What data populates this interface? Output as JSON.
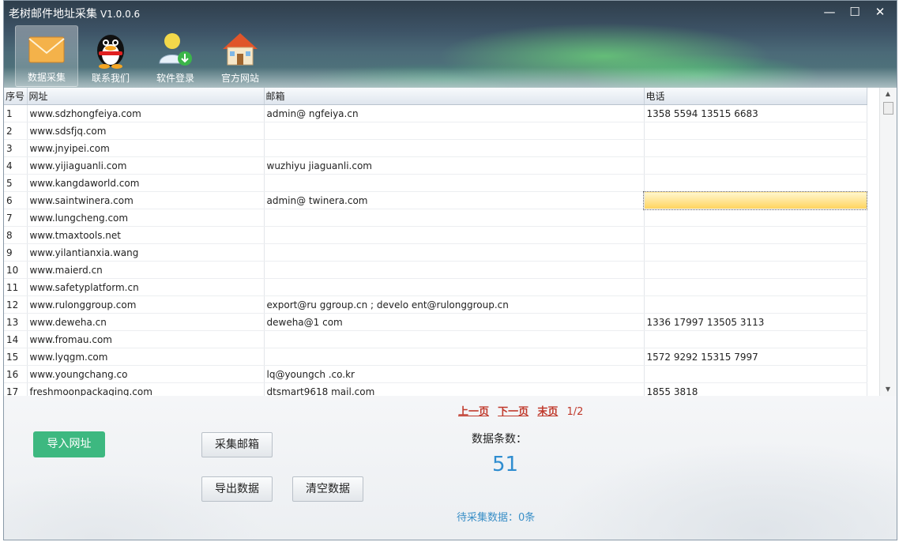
{
  "window": {
    "title": "老树邮件地址采集",
    "version": "V1.0.0.6",
    "controls": {
      "minimize": "—",
      "maximize": "☐",
      "close": "✕"
    }
  },
  "nav": [
    {
      "label": "数据采集",
      "icon": "envelope-icon"
    },
    {
      "label": "联系我们",
      "icon": "qq-penguin-icon"
    },
    {
      "label": "软件登录",
      "icon": "user-download-icon"
    },
    {
      "label": "官方网站",
      "icon": "house-icon"
    }
  ],
  "table": {
    "headers": {
      "index": "序号",
      "url": "网址",
      "email": "邮箱",
      "phone": "电话"
    },
    "rows": [
      {
        "index": "1",
        "url": "www.sdzhongfeiya.com",
        "email": "admin@  ngfeiya.cn",
        "phone": "1358   5594 13515   6683"
      },
      {
        "index": "2",
        "url": "www.sdsfjq.com",
        "email": "",
        "phone": ""
      },
      {
        "index": "3",
        "url": "www.jnyipei.com",
        "email": "",
        "phone": ""
      },
      {
        "index": "4",
        "url": "www.yijiaguanli.com",
        "email": "wuzhiyu   jiaguanli.com",
        "phone": ""
      },
      {
        "index": "5",
        "url": "www.kangdaworld.com",
        "email": "",
        "phone": ""
      },
      {
        "index": "6",
        "url": "www.saintwinera.com",
        "email": "admin@   twinera.com",
        "phone": ""
      },
      {
        "index": "7",
        "url": "www.lungcheng.com",
        "email": "",
        "phone": ""
      },
      {
        "index": "8",
        "url": "www.tmaxtools.net",
        "email": "",
        "phone": ""
      },
      {
        "index": "9",
        "url": "www.yilantianxia.wang",
        "email": "",
        "phone": ""
      },
      {
        "index": "10",
        "url": "www.maierd.cn",
        "email": "",
        "phone": ""
      },
      {
        "index": "11",
        "url": "www.safetyplatform.cn",
        "email": "",
        "phone": ""
      },
      {
        "index": "12",
        "url": "www.rulonggroup.com",
        "email": "export@ru  ggroup.cn ; develo   ent@rulonggroup.cn",
        "phone": ""
      },
      {
        "index": "13",
        "url": "www.deweha.cn",
        "email": "deweha@1   com",
        "phone": "1336   17997 13505   3113"
      },
      {
        "index": "14",
        "url": "www.fromau.com",
        "email": "",
        "phone": ""
      },
      {
        "index": "15",
        "url": "www.lyqgm.com",
        "email": "",
        "phone": "1572   9292 15315   7997"
      },
      {
        "index": "16",
        "url": "www.youngchang.co",
        "email": "lq@youngch   .co.kr",
        "phone": ""
      },
      {
        "index": "17",
        "url": "freshmoonpackaging.com",
        "email": "dtsmart9618   mail.com",
        "phone": "1855   3818"
      }
    ]
  },
  "pager": {
    "prev": "上一页",
    "next": "下一页",
    "last": "末页",
    "page": "1/2"
  },
  "buttons": {
    "import": "导入网址",
    "collect": "采集邮箱",
    "export": "导出数据",
    "clear": "清空数据"
  },
  "stats": {
    "count_label": "数据条数：",
    "count_value": "51",
    "pending": "待采集数据：0条"
  },
  "colors": {
    "accent_green": "#3db880",
    "count_blue": "#2f8dd0",
    "pager_red": "#c0392b"
  }
}
